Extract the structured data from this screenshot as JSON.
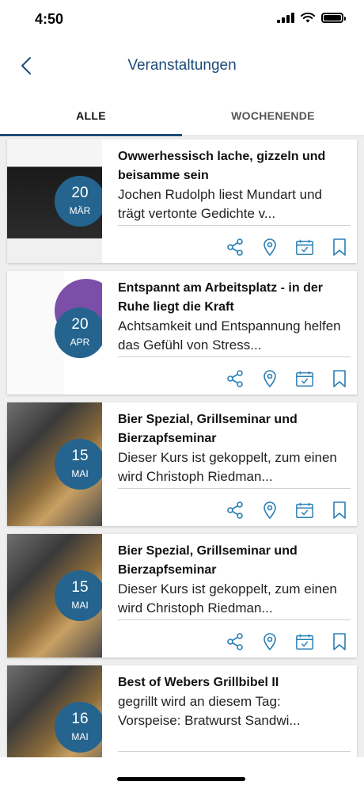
{
  "status": {
    "time": "4:50"
  },
  "header": {
    "title": "Veranstaltungen",
    "back_icon": "chevron-left-icon"
  },
  "tabs": [
    {
      "label": "ALLE",
      "active": true
    },
    {
      "label": "WOCHENENDE",
      "active": false
    }
  ],
  "colors": {
    "brand": "#1e4b78",
    "date_circle": "#24648f"
  },
  "events": [
    {
      "day": "20",
      "month": "MÄR",
      "title": "Owwerhessisch lache, gizzeln und beisamme sein",
      "desc": "Jochen Rudolph liest Mundart und trägt vertonte Gedichte v...",
      "image": "poster"
    },
    {
      "day": "20",
      "month": "APR",
      "title": "Entspannt am Arbeitsplatz - in der Ruhe liegt die Kraft",
      "desc": "Achtsamkeit und Entspannung helfen das Gefühl von Stress...",
      "image": "flyer"
    },
    {
      "day": "15",
      "month": "MAI",
      "title": "Bier Spezial, Grillseminar und Bierzapfseminar",
      "desc": "Dieser Kurs ist gekoppelt, zum einen wird Christoph Riedman...",
      "image": "grill"
    },
    {
      "day": "15",
      "month": "MAI",
      "title": "Bier Spezial, Grillseminar und Bierzapfseminar",
      "desc": "Dieser Kurs ist gekoppelt, zum einen wird Christoph Riedman...",
      "image": "grill"
    },
    {
      "day": "16",
      "month": "MAI",
      "title": "Best of Webers Grillbibel II",
      "desc": "gegrillt wird an diesem Tag: Vorspeise: Bratwurst Sandwi...",
      "image": "grill"
    }
  ],
  "action_icons": [
    "share-icon",
    "location-pin-icon",
    "calendar-icon",
    "bookmark-icon"
  ]
}
